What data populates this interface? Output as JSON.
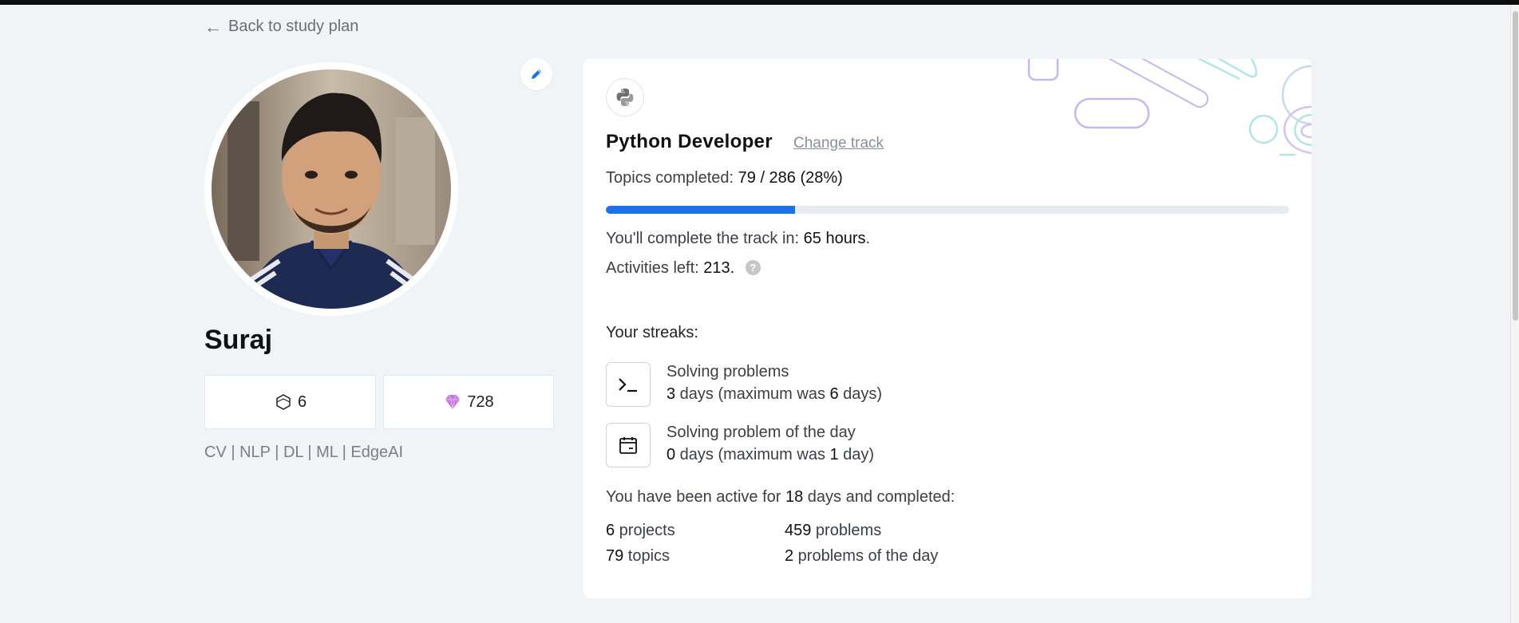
{
  "nav": {
    "back_label": "Back to study plan"
  },
  "profile": {
    "name": "Suraj",
    "level": "6",
    "gems": "728",
    "bio": "CV | NLP | DL | ML | EdgeAI"
  },
  "track": {
    "title": "Python Developer",
    "change_label": "Change track",
    "topics_label": "Topics completed:",
    "topics_value": "79 / 286 (28%)",
    "progress_fraction": 0.277,
    "complete_prefix": "You'll complete the track in:",
    "complete_value": "65 hours",
    "complete_suffix": ".",
    "activities_prefix": "Activities left:",
    "activities_value": "213.",
    "help_glyph": "?"
  },
  "streaks": {
    "heading": "Your streaks:",
    "items": [
      {
        "icon": "terminal-icon",
        "title": "Solving problems",
        "current": "3",
        "mid": " days (maximum was ",
        "max": "6",
        "end": " days)"
      },
      {
        "icon": "calendar-icon",
        "title": "Solving problem of the day",
        "current": "0",
        "mid": " days (maximum was ",
        "max": "1",
        "end": " day)"
      }
    ]
  },
  "activity": {
    "prefix": "You have been active for ",
    "days": "18",
    "suffix": " days and completed:",
    "stats": [
      {
        "value": "6",
        "label": " projects"
      },
      {
        "value": "459",
        "label": " problems"
      },
      {
        "value": "79",
        "label": " topics"
      },
      {
        "value": "2",
        "label": " problems of the day"
      }
    ]
  },
  "colors": {
    "accent": "#1a73e8",
    "gem": "#c77ae6",
    "background": "#f1f4f7"
  }
}
